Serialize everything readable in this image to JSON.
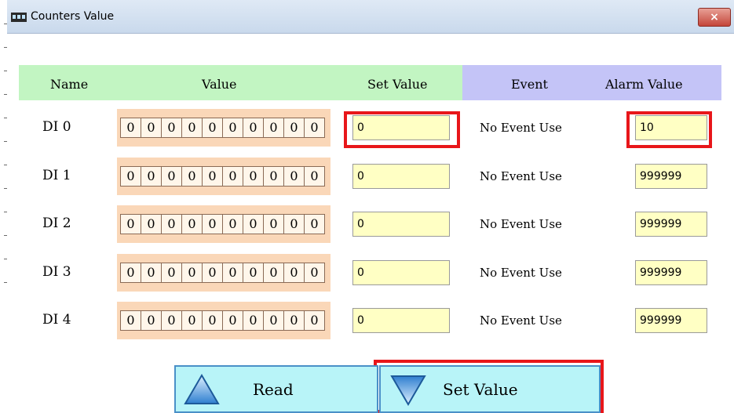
{
  "window": {
    "title": "Counters Value",
    "close_label": "×"
  },
  "headers": {
    "name": "Name",
    "value": "Value",
    "set_value": "Set Value",
    "event": "Event",
    "alarm_value": "Alarm Value"
  },
  "rows": [
    {
      "label": "DI 0",
      "digits": [
        "0",
        "0",
        "0",
        "0",
        "0",
        "0",
        "0",
        "0",
        "0",
        "0"
      ],
      "set_value": "0",
      "event": "No Event Use",
      "alarm_value": "10"
    },
    {
      "label": "DI 1",
      "digits": [
        "0",
        "0",
        "0",
        "0",
        "0",
        "0",
        "0",
        "0",
        "0",
        "0"
      ],
      "set_value": "0",
      "event": "No Event Use",
      "alarm_value": "999999"
    },
    {
      "label": "DI 2",
      "digits": [
        "0",
        "0",
        "0",
        "0",
        "0",
        "0",
        "0",
        "0",
        "0",
        "0"
      ],
      "set_value": "0",
      "event": "No Event Use",
      "alarm_value": "999999"
    },
    {
      "label": "DI 3",
      "digits": [
        "0",
        "0",
        "0",
        "0",
        "0",
        "0",
        "0",
        "0",
        "0",
        "0"
      ],
      "set_value": "0",
      "event": "No Event Use",
      "alarm_value": "999999"
    },
    {
      "label": "DI 4",
      "digits": [
        "0",
        "0",
        "0",
        "0",
        "0",
        "0",
        "0",
        "0",
        "0",
        "0"
      ],
      "set_value": "0",
      "event": "No Event Use",
      "alarm_value": "999999"
    }
  ],
  "buttons": {
    "read": "Read",
    "set_value": "Set Value"
  },
  "colors": {
    "header_green": "#c2f5c2",
    "header_purple": "#c4c4f7",
    "value_bg": "#fad7b8",
    "input_bg": "#ffffc4",
    "highlight": "#e8161a",
    "button_bg": "#b8f4f8"
  },
  "icons": {
    "read": "triangle-up-icon",
    "set_value": "triangle-down-icon",
    "app": "counter-app-icon",
    "close": "close-icon"
  }
}
